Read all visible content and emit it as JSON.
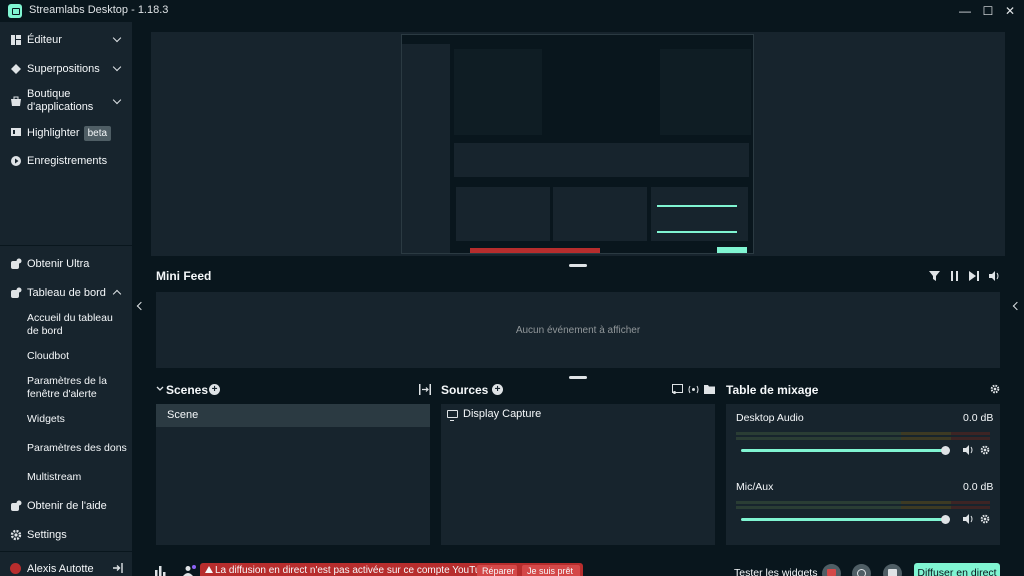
{
  "window": {
    "title": "Streamlabs Desktop - 1.18.3",
    "controls": {
      "minimize": "—",
      "maximize": "☐",
      "close": "✕"
    }
  },
  "sidebar": {
    "top_items": [
      {
        "label": "Éditeur",
        "icon": "editor-icon"
      },
      {
        "label": "Superpositions",
        "icon": "overlays-icon"
      },
      {
        "label": "Boutique d'applications",
        "icon": "app-store-icon"
      },
      {
        "label": "Highlighter",
        "icon": "highlighter-icon",
        "badge": "beta"
      },
      {
        "label": "Enregistrements",
        "icon": "recordings-icon"
      }
    ],
    "bottom_items": {
      "ultra": "Obtenir Ultra",
      "dashboard": "Tableau de bord",
      "dashboard_sub": [
        "Accueil du tableau de bord",
        "Cloudbot",
        "Paramètres de la fenêtre d'alerte",
        "Widgets",
        "Paramètres des dons",
        "Multistream"
      ],
      "help": "Obtenir de l'aide",
      "settings": "Settings",
      "user": "Alexis Autotte"
    }
  },
  "minifeed": {
    "title": "Mini Feed",
    "empty": "Aucun événement à afficher"
  },
  "scenes": {
    "title": "Scenes",
    "items": [
      "Scene"
    ]
  },
  "sources": {
    "title": "Sources",
    "items": [
      "Display Capture"
    ]
  },
  "mixer": {
    "title": "Table de mixage",
    "channels": [
      {
        "name": "Desktop Audio",
        "db": "0.0 dB",
        "level": 1.0
      },
      {
        "name": "Mic/Aux",
        "db": "0.0 dB",
        "level": 1.0
      }
    ]
  },
  "footer": {
    "warning": "La diffusion en direct n'est pas activée sur ce compte YouTube",
    "retry": "Réparer",
    "ready": "Je suis prêt",
    "test_widgets": "Tester les widgets",
    "go_live": "Diffuser en direct"
  },
  "colors": {
    "accent": "#80f5d2",
    "background": "#09161d",
    "panel": "#17242d",
    "warning": "#b72d2d"
  }
}
